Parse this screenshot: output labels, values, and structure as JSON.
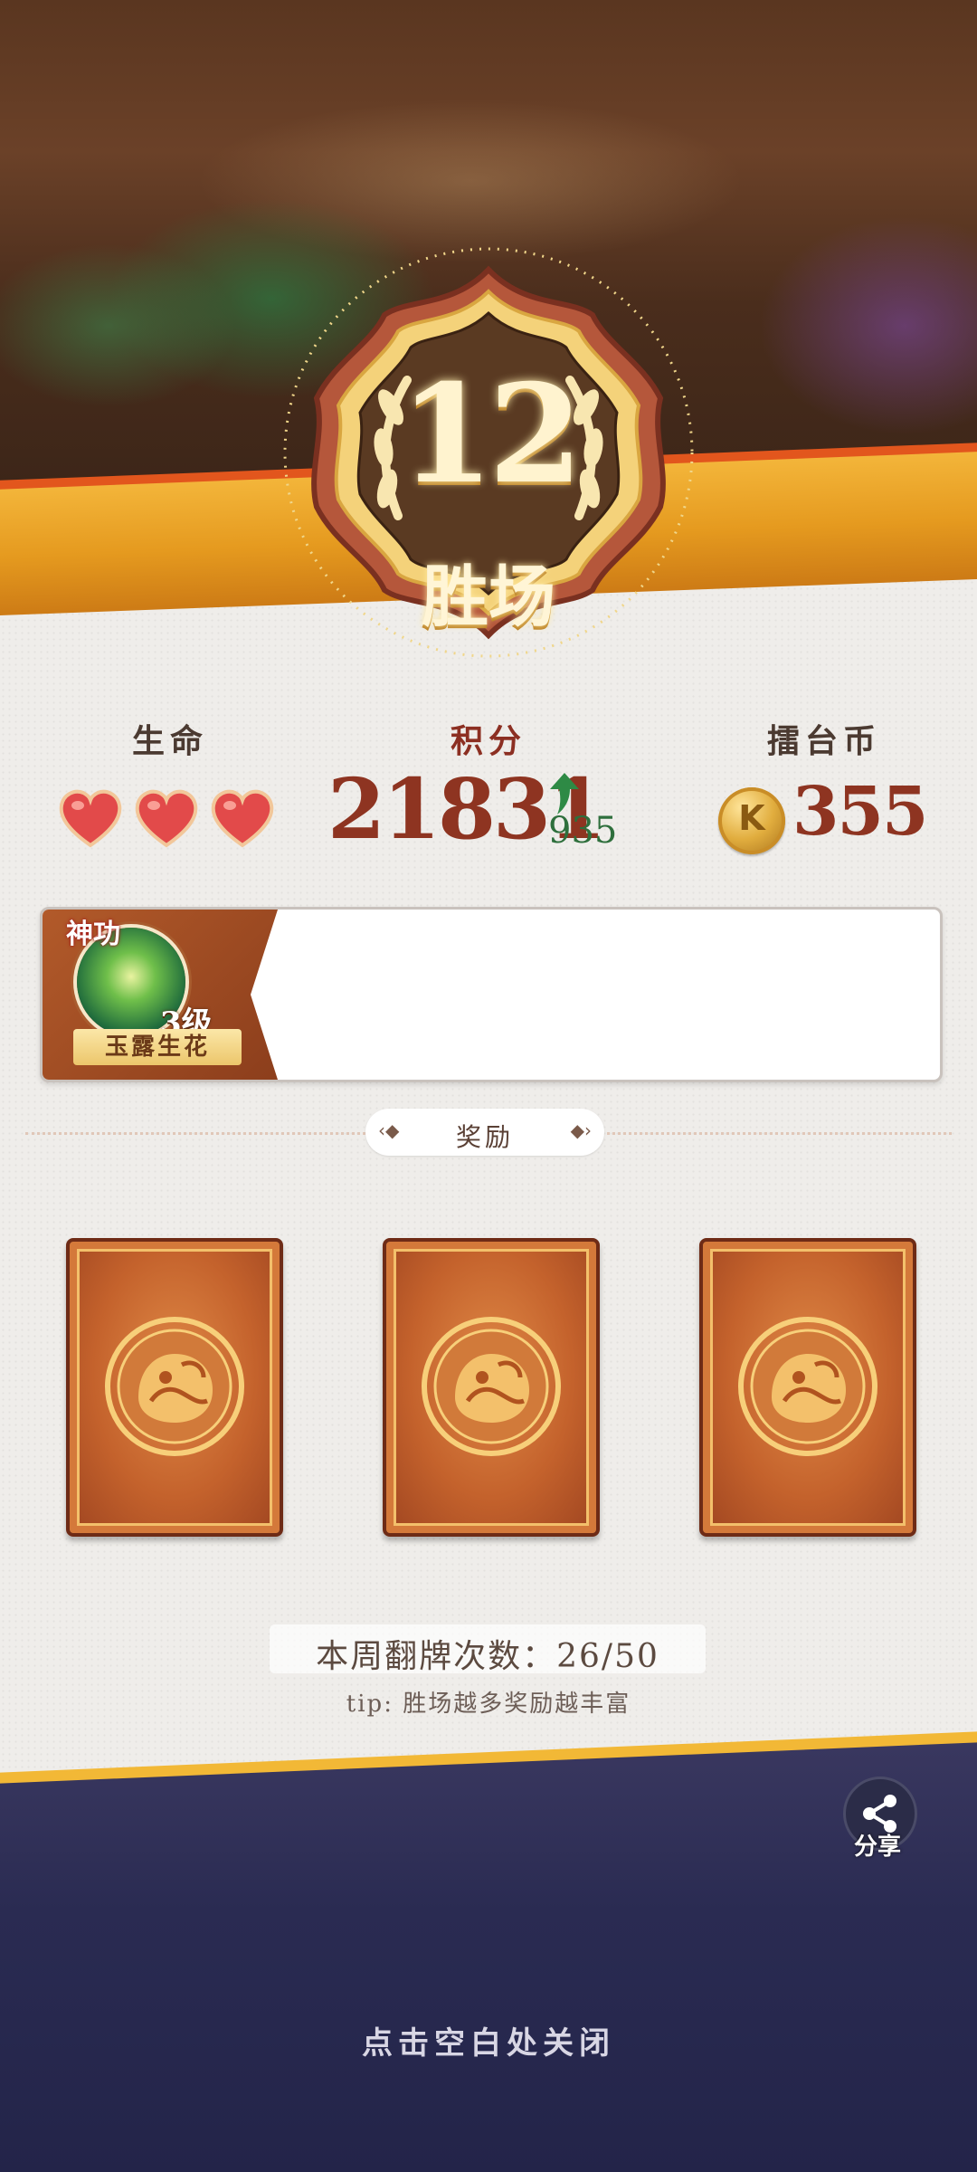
{
  "result": {
    "wins": "12",
    "wins_label": "胜场"
  },
  "stats": {
    "life_label": "生命",
    "lives": 3,
    "points_label": "积分",
    "points_value": "21831",
    "points_delta": "935",
    "coin_label": "擂台币",
    "coin_symbol": "K",
    "coin_value": "355"
  },
  "skill": {
    "tag": "神功",
    "level": "3级",
    "name": "玉露生花"
  },
  "reward": {
    "label": "奖励",
    "cards": [
      "card-1",
      "card-2",
      "card-3"
    ]
  },
  "flip": {
    "count_text": "本周翻牌次数：26/50",
    "tip": "tip: 胜场越多奖励越丰富"
  },
  "share": {
    "label": "分享"
  },
  "close_hint": "点击空白处关闭",
  "colors": {
    "accent_orange": "#e59a1f",
    "score_red": "#8e3421",
    "delta_green": "#2e6f3c",
    "panel_bg": "#efedea",
    "bottom_navy": "#232449"
  }
}
